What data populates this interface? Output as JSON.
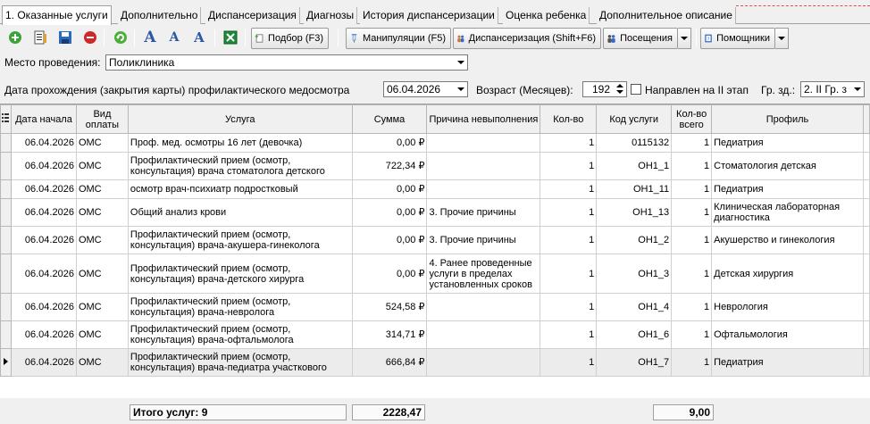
{
  "tabs": [
    {
      "label": "1. Оказанные услуги",
      "active": true
    },
    {
      "label": "Дополнительно"
    },
    {
      "label": "Диспансеризация"
    },
    {
      "label": "Диагнозы"
    },
    {
      "label": "История диспансеризации"
    },
    {
      "label": "Оценка ребенка"
    },
    {
      "label": "Дополнительное описание"
    }
  ],
  "toolbar": {
    "podbor": "Подбор (F3)",
    "manipulyatsii": "Манипуляции (F5)",
    "dispanserizatsiya": "Диспансеризация (Shift+F6)",
    "poseshcheniya": "Посещения",
    "pomoshchniki": "Помощники",
    "font_buttons": [
      "A",
      "A",
      "A"
    ]
  },
  "form": {
    "mesto_label": "Место проведения:",
    "mesto_value": "Поликлиника",
    "data_label": "Дата прохождения (закрытия карты) профилактического медосмотра",
    "data_value": "06.04.2026",
    "vozrast_label": "Возраст (Месяцев):",
    "vozrast_value": "192",
    "napravlen_label": "Направлен на II этап",
    "gr_zd_label": "Гр. зд.:",
    "gr_zd_value": "2. II Гр. з"
  },
  "columns": [
    "Дата начала",
    "Вид оплаты",
    "Услуга",
    "Сумма",
    "Причина невыполнения",
    "Кол-во",
    "Код услуги",
    "Кол-во всего",
    "Профиль"
  ],
  "rows": [
    {
      "date": "06.04.2026",
      "pay": "ОМС",
      "service": "Проф. мед. осмотры 16 лет (девочка)",
      "sum": "0,00 ₽",
      "reason": "",
      "qty": "1",
      "code": "0115132",
      "total": "1",
      "profile": "Педиатрия"
    },
    {
      "date": "06.04.2026",
      "pay": "ОМС",
      "service": "Профилактический прием (осмотр, консультация) врача стоматолога детского",
      "sum": "722,34 ₽",
      "reason": "",
      "qty": "1",
      "code": "ОН1_1",
      "total": "1",
      "profile": "Стоматология детская"
    },
    {
      "date": "06.04.2026",
      "pay": "ОМС",
      "service": "осмотр врач-психиатр подростковый",
      "sum": "0,00 ₽",
      "reason": "",
      "qty": "1",
      "code": "ОН1_11",
      "total": "1",
      "profile": "Педиатрия"
    },
    {
      "date": "06.04.2026",
      "pay": "ОМС",
      "service": "Общий анализ крови",
      "sum": "0,00 ₽",
      "reason": "3. Прочие причины",
      "qty": "1",
      "code": "ОН1_13",
      "total": "1",
      "profile": "Клиническая лабораторная диагностика"
    },
    {
      "date": "06.04.2026",
      "pay": "ОМС",
      "service": "Профилактический прием (осмотр, консультация) врача-акушера-гинеколога",
      "sum": "0,00 ₽",
      "reason": "3. Прочие причины",
      "qty": "1",
      "code": "ОН1_2",
      "total": "1",
      "profile": "Акушерство и гинекология"
    },
    {
      "date": "06.04.2026",
      "pay": "ОМС",
      "service": "Профилактический прием (осмотр, консультация) врача-детского хирурга",
      "sum": "0,00 ₽",
      "reason": "4. Ранее проведенные услуги в пределах установленных сроков",
      "qty": "1",
      "code": "ОН1_3",
      "total": "1",
      "profile": "Детская хирургия"
    },
    {
      "date": "06.04.2026",
      "pay": "ОМС",
      "service": "Профилактический прием (осмотр, консультация) врача-невролога",
      "sum": "524,58 ₽",
      "reason": "",
      "qty": "1",
      "code": "ОН1_4",
      "total": "1",
      "profile": "Неврология"
    },
    {
      "date": "06.04.2026",
      "pay": "ОМС",
      "service": "Профилактический прием (осмотр, консультация) врача-офтальмолога",
      "sum": "314,71 ₽",
      "reason": "",
      "qty": "1",
      "code": "ОН1_6",
      "total": "1",
      "profile": "Офтальмология"
    },
    {
      "date": "06.04.2026",
      "pay": "ОМС",
      "service": "Профилактический прием (осмотр, консультация) врача-педиатра участкового",
      "sum": "666,84 ₽",
      "reason": "",
      "qty": "1",
      "code": "ОН1_7",
      "total": "1",
      "profile": "Педиатрия",
      "current": true
    }
  ],
  "footer": {
    "itogo": "Итого услуг: 9",
    "sum_total": "2228,47",
    "qty_total": "9,00"
  }
}
